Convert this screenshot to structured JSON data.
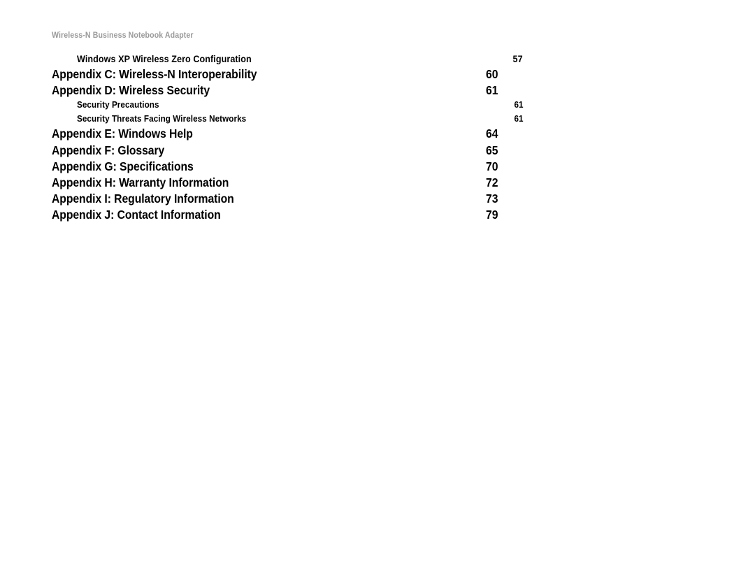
{
  "document": {
    "running_header": "Wireless-N Business Notebook Adapter",
    "header_color": "#9a9a9a",
    "text_color": "#000000",
    "background_color": "#ffffff"
  },
  "toc": {
    "entries": [
      {
        "level": 2,
        "title": "Windows XP Wireless Zero Configuration",
        "page": "57"
      },
      {
        "level": 1,
        "title": "Appendix C: Wireless-N Interoperability",
        "page": "60"
      },
      {
        "level": 1,
        "title": "Appendix D: Wireless Security",
        "page": "61"
      },
      {
        "level": 3,
        "title": "Security Precautions",
        "page": "61"
      },
      {
        "level": 3,
        "title": "Security Threats Facing Wireless Networks",
        "page": "61"
      },
      {
        "level": 1,
        "title": "Appendix E: Windows Help",
        "page": "64"
      },
      {
        "level": 1,
        "title": "Appendix F: Glossary",
        "page": "65"
      },
      {
        "level": 1,
        "title": "Appendix G: Specifications",
        "page": "70"
      },
      {
        "level": 1,
        "title": "Appendix H: Warranty Information",
        "page": "72"
      },
      {
        "level": 1,
        "title": "Appendix I: Regulatory Information",
        "page": "73"
      },
      {
        "level": 1,
        "title": "Appendix J: Contact Information",
        "page": "79"
      }
    ]
  }
}
